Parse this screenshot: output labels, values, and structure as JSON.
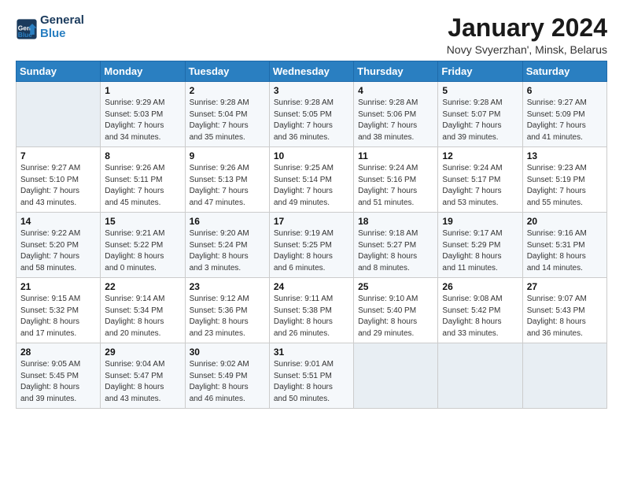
{
  "logo": {
    "line1": "General",
    "line2": "Blue"
  },
  "title": "January 2024",
  "subtitle": "Novy Svyerzhan', Minsk, Belarus",
  "days_header": [
    "Sunday",
    "Monday",
    "Tuesday",
    "Wednesday",
    "Thursday",
    "Friday",
    "Saturday"
  ],
  "weeks": [
    [
      {
        "num": "",
        "info": ""
      },
      {
        "num": "1",
        "info": "Sunrise: 9:29 AM\nSunset: 5:03 PM\nDaylight: 7 hours\nand 34 minutes."
      },
      {
        "num": "2",
        "info": "Sunrise: 9:28 AM\nSunset: 5:04 PM\nDaylight: 7 hours\nand 35 minutes."
      },
      {
        "num": "3",
        "info": "Sunrise: 9:28 AM\nSunset: 5:05 PM\nDaylight: 7 hours\nand 36 minutes."
      },
      {
        "num": "4",
        "info": "Sunrise: 9:28 AM\nSunset: 5:06 PM\nDaylight: 7 hours\nand 38 minutes."
      },
      {
        "num": "5",
        "info": "Sunrise: 9:28 AM\nSunset: 5:07 PM\nDaylight: 7 hours\nand 39 minutes."
      },
      {
        "num": "6",
        "info": "Sunrise: 9:27 AM\nSunset: 5:09 PM\nDaylight: 7 hours\nand 41 minutes."
      }
    ],
    [
      {
        "num": "7",
        "info": "Sunrise: 9:27 AM\nSunset: 5:10 PM\nDaylight: 7 hours\nand 43 minutes."
      },
      {
        "num": "8",
        "info": "Sunrise: 9:26 AM\nSunset: 5:11 PM\nDaylight: 7 hours\nand 45 minutes."
      },
      {
        "num": "9",
        "info": "Sunrise: 9:26 AM\nSunset: 5:13 PM\nDaylight: 7 hours\nand 47 minutes."
      },
      {
        "num": "10",
        "info": "Sunrise: 9:25 AM\nSunset: 5:14 PM\nDaylight: 7 hours\nand 49 minutes."
      },
      {
        "num": "11",
        "info": "Sunrise: 9:24 AM\nSunset: 5:16 PM\nDaylight: 7 hours\nand 51 minutes."
      },
      {
        "num": "12",
        "info": "Sunrise: 9:24 AM\nSunset: 5:17 PM\nDaylight: 7 hours\nand 53 minutes."
      },
      {
        "num": "13",
        "info": "Sunrise: 9:23 AM\nSunset: 5:19 PM\nDaylight: 7 hours\nand 55 minutes."
      }
    ],
    [
      {
        "num": "14",
        "info": "Sunrise: 9:22 AM\nSunset: 5:20 PM\nDaylight: 7 hours\nand 58 minutes."
      },
      {
        "num": "15",
        "info": "Sunrise: 9:21 AM\nSunset: 5:22 PM\nDaylight: 8 hours\nand 0 minutes."
      },
      {
        "num": "16",
        "info": "Sunrise: 9:20 AM\nSunset: 5:24 PM\nDaylight: 8 hours\nand 3 minutes."
      },
      {
        "num": "17",
        "info": "Sunrise: 9:19 AM\nSunset: 5:25 PM\nDaylight: 8 hours\nand 6 minutes."
      },
      {
        "num": "18",
        "info": "Sunrise: 9:18 AM\nSunset: 5:27 PM\nDaylight: 8 hours\nand 8 minutes."
      },
      {
        "num": "19",
        "info": "Sunrise: 9:17 AM\nSunset: 5:29 PM\nDaylight: 8 hours\nand 11 minutes."
      },
      {
        "num": "20",
        "info": "Sunrise: 9:16 AM\nSunset: 5:31 PM\nDaylight: 8 hours\nand 14 minutes."
      }
    ],
    [
      {
        "num": "21",
        "info": "Sunrise: 9:15 AM\nSunset: 5:32 PM\nDaylight: 8 hours\nand 17 minutes."
      },
      {
        "num": "22",
        "info": "Sunrise: 9:14 AM\nSunset: 5:34 PM\nDaylight: 8 hours\nand 20 minutes."
      },
      {
        "num": "23",
        "info": "Sunrise: 9:12 AM\nSunset: 5:36 PM\nDaylight: 8 hours\nand 23 minutes."
      },
      {
        "num": "24",
        "info": "Sunrise: 9:11 AM\nSunset: 5:38 PM\nDaylight: 8 hours\nand 26 minutes."
      },
      {
        "num": "25",
        "info": "Sunrise: 9:10 AM\nSunset: 5:40 PM\nDaylight: 8 hours\nand 29 minutes."
      },
      {
        "num": "26",
        "info": "Sunrise: 9:08 AM\nSunset: 5:42 PM\nDaylight: 8 hours\nand 33 minutes."
      },
      {
        "num": "27",
        "info": "Sunrise: 9:07 AM\nSunset: 5:43 PM\nDaylight: 8 hours\nand 36 minutes."
      }
    ],
    [
      {
        "num": "28",
        "info": "Sunrise: 9:05 AM\nSunset: 5:45 PM\nDaylight: 8 hours\nand 39 minutes."
      },
      {
        "num": "29",
        "info": "Sunrise: 9:04 AM\nSunset: 5:47 PM\nDaylight: 8 hours\nand 43 minutes."
      },
      {
        "num": "30",
        "info": "Sunrise: 9:02 AM\nSunset: 5:49 PM\nDaylight: 8 hours\nand 46 minutes."
      },
      {
        "num": "31",
        "info": "Sunrise: 9:01 AM\nSunset: 5:51 PM\nDaylight: 8 hours\nand 50 minutes."
      },
      {
        "num": "",
        "info": ""
      },
      {
        "num": "",
        "info": ""
      },
      {
        "num": "",
        "info": ""
      }
    ]
  ]
}
